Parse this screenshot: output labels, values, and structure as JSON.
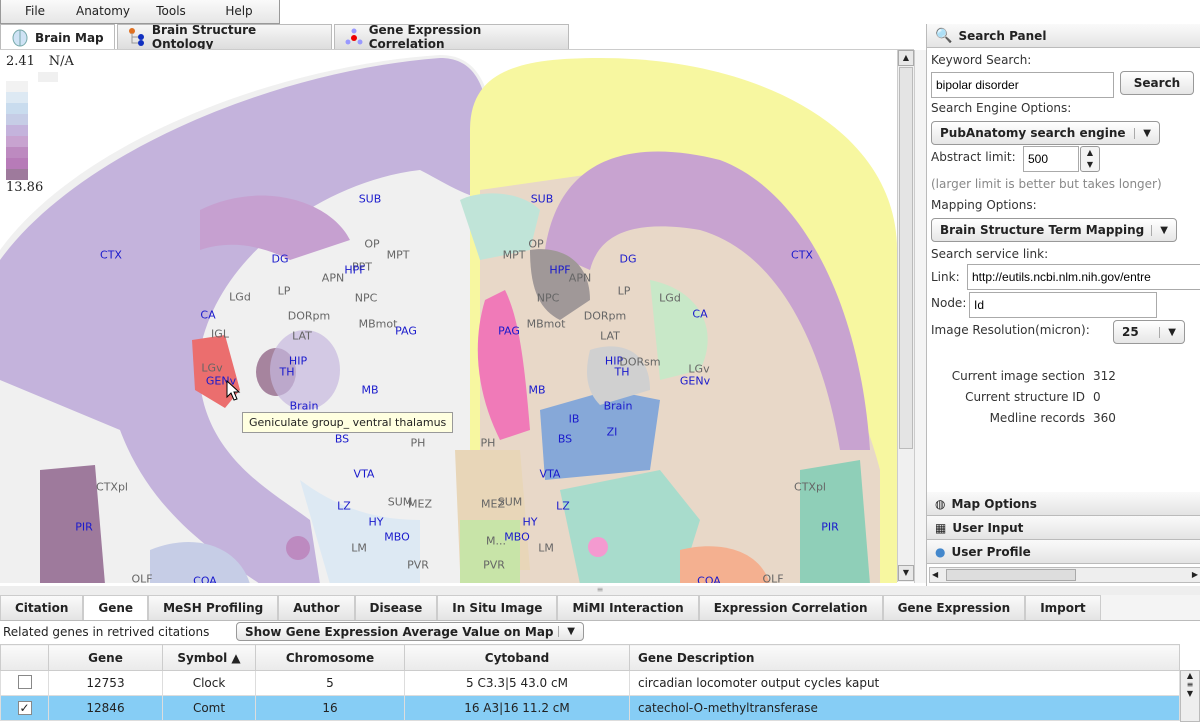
{
  "menu": [
    "File",
    "Anatomy",
    "Tools",
    "Help"
  ],
  "tabs": [
    {
      "label": "Brain Map",
      "icon": "brain-icon",
      "active": true
    },
    {
      "label": "Brain Structure Ontology",
      "icon": "ontology-tree-icon"
    },
    {
      "label": "Gene Expression Correlation",
      "icon": "correlation-dots-icon"
    }
  ],
  "legend": {
    "min": "2.41",
    "na": "N/A",
    "max": "13.86",
    "colors": [
      "#f2f2f2",
      "#dde9f3",
      "#c9dcee",
      "#c6cde6",
      "#c4b3dc",
      "#c8a3d0",
      "#bd8ac0",
      "#b77bb8",
      "#9e7a9c"
    ]
  },
  "map": {
    "tooltip": "Geniculate group_ ventral thalamus",
    "left_labels": [
      [
        "SUB",
        370,
        198,
        1
      ],
      [
        "OP",
        372,
        243,
        0
      ],
      [
        "MPT",
        398,
        254,
        0
      ],
      [
        "PPT",
        362,
        266,
        0
      ],
      [
        "DG",
        280,
        258,
        1
      ],
      [
        "HPF",
        355,
        269,
        1
      ],
      [
        "APN",
        333,
        277,
        0
      ],
      [
        "CTX",
        111,
        254,
        1
      ],
      [
        "LGd",
        240,
        296,
        0
      ],
      [
        "LP",
        284,
        290,
        0
      ],
      [
        "NPC",
        366,
        297,
        0
      ],
      [
        "CA",
        208,
        314,
        1
      ],
      [
        "DORpm",
        309,
        315,
        0
      ],
      [
        "MBmot",
        378,
        323,
        0
      ],
      [
        "PAG",
        406,
        330,
        1
      ],
      [
        "IGL",
        220,
        333,
        0
      ],
      [
        "LAT",
        302,
        335,
        0
      ],
      [
        "HIP",
        298,
        360,
        1
      ],
      [
        "TH",
        287,
        371,
        1
      ],
      [
        "LGv",
        212,
        367,
        0
      ],
      [
        "GENv",
        221,
        380,
        1
      ],
      [
        "MB",
        370,
        389,
        1
      ],
      [
        "Brain",
        304,
        405,
        1
      ],
      [
        "BS",
        342,
        438,
        1
      ],
      [
        "PH",
        418,
        442,
        0
      ],
      [
        "VTA",
        364,
        473,
        1
      ],
      [
        "CTXpl",
        112,
        486,
        0
      ],
      [
        "SUM",
        400,
        501,
        0
      ],
      [
        "MEZ",
        420,
        503,
        0
      ],
      [
        "LZ",
        344,
        505,
        1
      ],
      [
        "HY",
        376,
        521,
        1
      ],
      [
        "PIR",
        84,
        526,
        1
      ],
      [
        "MBO",
        397,
        536,
        1
      ],
      [
        "LM",
        359,
        547,
        0
      ],
      [
        "PVR",
        418,
        564,
        0
      ],
      [
        "COA",
        205,
        580,
        1
      ],
      [
        "OLF",
        142,
        578,
        0
      ]
    ],
    "right_labels": [
      [
        "SUB",
        542,
        198,
        1
      ],
      [
        "OP",
        536,
        243,
        0
      ],
      [
        "MPT",
        514,
        254,
        0
      ],
      [
        "HPF",
        560,
        269,
        1
      ],
      [
        "DG",
        628,
        258,
        1
      ],
      [
        "CTX",
        802,
        254,
        1
      ],
      [
        "APN",
        580,
        277,
        0
      ],
      [
        "LP",
        624,
        290,
        0
      ],
      [
        "LGd",
        670,
        297,
        0
      ],
      [
        "NPC",
        548,
        297,
        0
      ],
      [
        "CA",
        700,
        313,
        1
      ],
      [
        "DORpm",
        605,
        315,
        0
      ],
      [
        "MBmot",
        546,
        323,
        0
      ],
      [
        "PAG",
        509,
        330,
        1
      ],
      [
        "LAT",
        610,
        335,
        0
      ],
      [
        "HIP",
        614,
        360,
        1
      ],
      [
        "DORsm",
        640,
        361,
        0
      ],
      [
        "TH",
        622,
        371,
        1
      ],
      [
        "LGv",
        699,
        368,
        0
      ],
      [
        "GENv",
        695,
        380,
        1
      ],
      [
        "MB",
        537,
        389,
        1
      ],
      [
        "Brain",
        618,
        405,
        1
      ],
      [
        "IB",
        574,
        418,
        1
      ],
      [
        "ZI",
        612,
        431,
        1
      ],
      [
        "BS",
        565,
        438,
        1
      ],
      [
        "PH",
        488,
        442,
        0
      ],
      [
        "VTA",
        550,
        473,
        1
      ],
      [
        "CTXpl",
        810,
        486,
        0
      ],
      [
        "LZ",
        563,
        505,
        1
      ],
      [
        "SUM",
        510,
        501,
        0
      ],
      [
        "MEZ",
        493,
        503,
        0
      ],
      [
        "HY",
        530,
        521,
        1
      ],
      [
        "PIR",
        830,
        526,
        1
      ],
      [
        "MBO",
        517,
        536,
        1
      ],
      [
        "M...",
        496,
        540,
        0
      ],
      [
        "LM",
        546,
        547,
        0
      ],
      [
        "PVR",
        494,
        564,
        0
      ],
      [
        "COA",
        709,
        580,
        1
      ],
      [
        "OLF",
        773,
        578,
        0
      ]
    ]
  },
  "panel": {
    "title": "Search Panel",
    "keyword_label": "Keyword Search:",
    "keyword_value": "bipolar disorder",
    "search_btn": "Search",
    "engine_label": "Search Engine Options:",
    "engine_value": "PubAnatomy search engine",
    "abstract_label": "Abstract limit:",
    "abstract_value": "500",
    "abstract_hint": "(larger limit is better but takes longer)",
    "mapping_label": "Mapping Options:",
    "mapping_value": "Brain Structure Term Mapping",
    "service_label": "Search service link:",
    "link_label": "Link:",
    "link_value": "http://eutils.ncbi.nlm.nih.gov/entre",
    "node_label": "Node:",
    "node_value": "Id",
    "res_label": "Image Resolution(micron):",
    "res_value": "25",
    "stats": [
      {
        "label": "Current image section",
        "value": "312"
      },
      {
        "label": "Current structure ID",
        "value": "0"
      },
      {
        "label": "Medline records",
        "value": "360"
      }
    ],
    "accordion": [
      "Map Options",
      "User Input",
      "User Profile"
    ]
  },
  "bottom": {
    "tabs": [
      "Citation",
      "Gene",
      "MeSH Profiling",
      "Author",
      "Disease",
      "In Situ Image",
      "MiMI Interaction",
      "Expression Correlation",
      "Gene Expression",
      "Import"
    ],
    "active_tab": "Gene",
    "related_label": "Related genes in retrived citations",
    "show_dropdown": "Show Gene Expression Average Value on Map",
    "columns": [
      "",
      "Gene",
      "Symbol ▲",
      "Chromosome",
      "Cytoband",
      "Gene Description"
    ],
    "rows": [
      {
        "checked": false,
        "gene": "12753",
        "symbol": "Clock",
        "chromosome": "5",
        "cytoband": "5 C3.3|5 43.0 cM",
        "description": "circadian locomoter output cycles kaput"
      },
      {
        "checked": true,
        "gene": "12846",
        "symbol": "Comt",
        "chromosome": "16",
        "cytoband": "16 A3|16 11.2 cM",
        "description": "catechol-O-methyltransferase"
      }
    ]
  }
}
